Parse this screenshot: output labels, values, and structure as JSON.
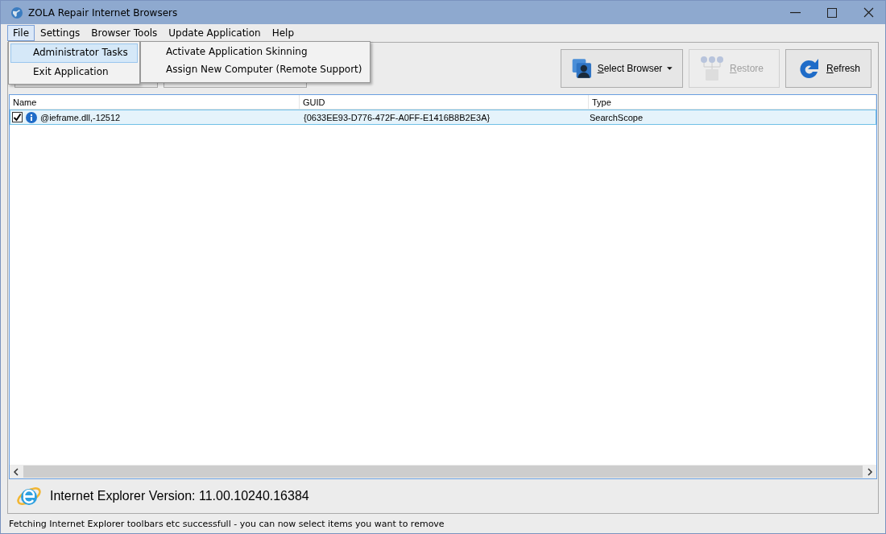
{
  "window": {
    "title": "ZOLA Repair Internet Browsers"
  },
  "menu_bar": [
    {
      "label": "File",
      "selected": true
    },
    {
      "label": "Settings",
      "selected": false
    },
    {
      "label": "Browser Tools",
      "selected": false
    },
    {
      "label": "Update Application",
      "selected": false
    },
    {
      "label": "Help",
      "selected": false
    }
  ],
  "file_menu": [
    {
      "label": "Administrator Tasks",
      "selected": true
    },
    {
      "label": "Exit Application",
      "selected": false
    }
  ],
  "submenu": [
    {
      "label": "Activate Application Skinning"
    },
    {
      "label": "Assign New Computer (Remote Support)"
    }
  ],
  "toolbar": [
    {
      "kind": "browser",
      "label": "Select Browser",
      "disabled": false,
      "dropdown": true
    },
    {
      "kind": "restore",
      "label": "Restore",
      "disabled": true,
      "dropdown": false
    },
    {
      "kind": "refresh",
      "label": "Refresh",
      "disabled": false,
      "dropdown": false
    }
  ],
  "table": {
    "columns": [
      "Name",
      "GUID",
      "Type"
    ],
    "rows": [
      {
        "checked": true,
        "selected": true,
        "cells": [
          "@ieframe.dll,-12512",
          "{0633EE93-D776-472F-A0FF-E1416B8B2E3A}",
          "SearchScope"
        ]
      }
    ]
  },
  "info": {
    "text": "Internet Explorer Version: 11.00.10240.16384"
  },
  "status_bar": {
    "text": "Fetching Internet Explorer toolbars etc successfull - you can now select items you want to remove"
  }
}
